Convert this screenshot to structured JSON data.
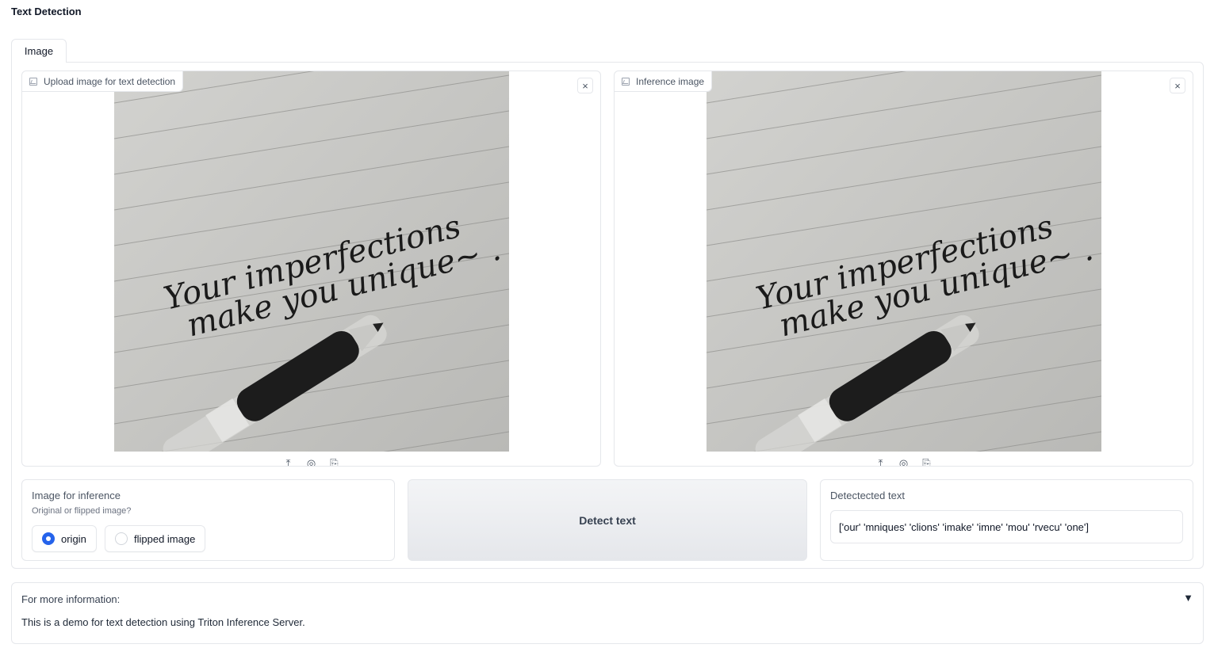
{
  "app": {
    "title": "Text Detection"
  },
  "tabs": [
    {
      "label": "Image",
      "active": true
    }
  ],
  "upload_image": {
    "label": "Upload image for text detection",
    "close_label": "×"
  },
  "inference_image": {
    "label": "Inference image",
    "close_label": "×"
  },
  "image_toolbar": {
    "upload": "⤒",
    "webcam": "◎",
    "clipboard": "⎘"
  },
  "inference_choice": {
    "label": "Image for inference",
    "info": "Original or flipped image?",
    "options": [
      {
        "label": "origin",
        "checked": true
      },
      {
        "label": "flipped image",
        "checked": false
      }
    ]
  },
  "detect_button": {
    "label": "Detect text"
  },
  "detected_text": {
    "label": "Detectected text",
    "value": "['our' 'mniques' 'clions' 'imake' 'imne' 'mou' 'rvecu' 'one']"
  },
  "accordion": {
    "title": "For more information:",
    "toggle": "▼",
    "body": "This is a demo for text detection using Triton Inference Server."
  },
  "colors": {
    "accent": "#2563eb",
    "border": "#e5e7eb",
    "paper": "#c9c9c6",
    "pen_body": "#1c1c1c"
  }
}
